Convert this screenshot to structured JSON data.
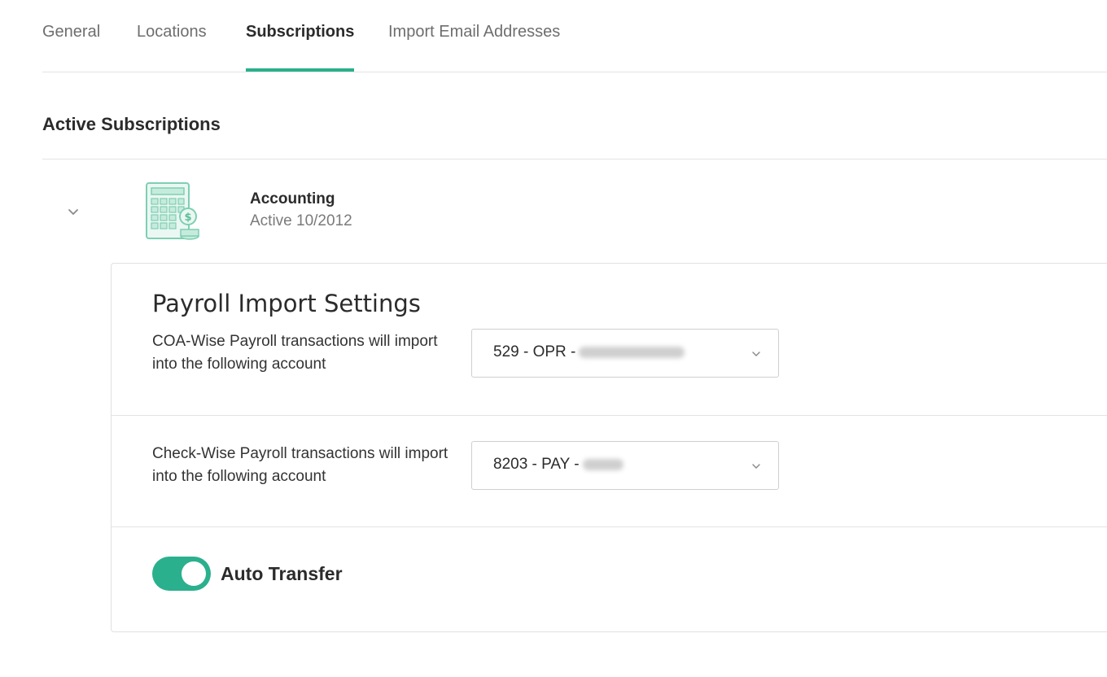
{
  "tabs": [
    {
      "label": "General"
    },
    {
      "label": "Locations"
    },
    {
      "label": "Subscriptions"
    },
    {
      "label": "Import Email Addresses"
    }
  ],
  "active_tab": "Subscriptions",
  "section": {
    "title": "Active Subscriptions"
  },
  "subscription": {
    "name": "Accounting",
    "status": "Active 10/2012",
    "icon": "calculator-money-icon"
  },
  "panel": {
    "title": "Payroll Import Settings",
    "coa": {
      "label": "COA-Wise Payroll transactions will import into the following account",
      "value": "529 - OPR -"
    },
    "check": {
      "label": "Check-Wise Payroll transactions will import into the following account",
      "value": "8203 - PAY -"
    },
    "auto_transfer": {
      "label": "Auto Transfer",
      "enabled": true
    }
  },
  "colors": {
    "accent": "#2bb08d",
    "divider": "#e3e3e3",
    "muted_text": "#6e6e6e"
  }
}
